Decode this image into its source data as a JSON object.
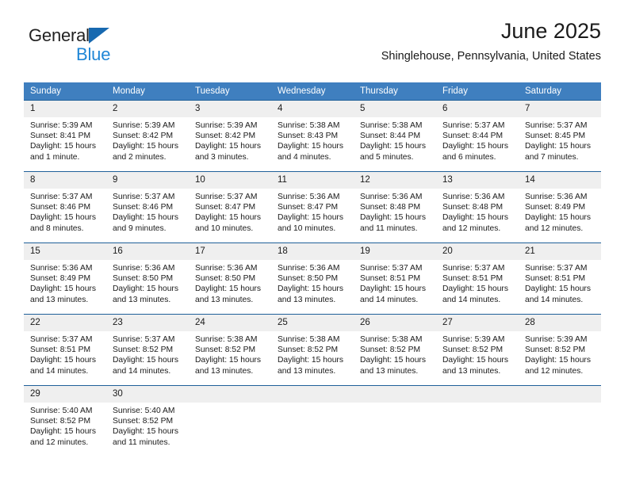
{
  "brand": {
    "name_top": "General",
    "name_bottom": "Blue",
    "accent_color": "#1769b0",
    "blue_text_color": "#1f86d6"
  },
  "header": {
    "title": "June 2025",
    "subtitle": "Shinglehouse, Pennsylvania, United States"
  },
  "theme": {
    "header_row_bg": "#3f7fbf",
    "daynum_bg": "#efefef",
    "grid_line": "#1f6099",
    "text": "#1a1a1a"
  },
  "weekday_headers": [
    "Sunday",
    "Monday",
    "Tuesday",
    "Wednesday",
    "Thursday",
    "Friday",
    "Saturday"
  ],
  "chart_data": {
    "type": "table",
    "title": "June 2025 — Sunrise, Sunset and Daylight",
    "location": "Shinglehouse, Pennsylvania, United States",
    "columns": [
      "Sunday",
      "Monday",
      "Tuesday",
      "Wednesday",
      "Thursday",
      "Friday",
      "Saturday"
    ],
    "days": [
      {
        "date": 1,
        "sunrise": "5:39 AM",
        "sunset": "8:41 PM",
        "daylight_hours": 15,
        "daylight_minutes": 1
      },
      {
        "date": 2,
        "sunrise": "5:39 AM",
        "sunset": "8:42 PM",
        "daylight_hours": 15,
        "daylight_minutes": 2
      },
      {
        "date": 3,
        "sunrise": "5:39 AM",
        "sunset": "8:42 PM",
        "daylight_hours": 15,
        "daylight_minutes": 3
      },
      {
        "date": 4,
        "sunrise": "5:38 AM",
        "sunset": "8:43 PM",
        "daylight_hours": 15,
        "daylight_minutes": 4
      },
      {
        "date": 5,
        "sunrise": "5:38 AM",
        "sunset": "8:44 PM",
        "daylight_hours": 15,
        "daylight_minutes": 5
      },
      {
        "date": 6,
        "sunrise": "5:37 AM",
        "sunset": "8:44 PM",
        "daylight_hours": 15,
        "daylight_minutes": 6
      },
      {
        "date": 7,
        "sunrise": "5:37 AM",
        "sunset": "8:45 PM",
        "daylight_hours": 15,
        "daylight_minutes": 7
      },
      {
        "date": 8,
        "sunrise": "5:37 AM",
        "sunset": "8:46 PM",
        "daylight_hours": 15,
        "daylight_minutes": 8
      },
      {
        "date": 9,
        "sunrise": "5:37 AM",
        "sunset": "8:46 PM",
        "daylight_hours": 15,
        "daylight_minutes": 9
      },
      {
        "date": 10,
        "sunrise": "5:37 AM",
        "sunset": "8:47 PM",
        "daylight_hours": 15,
        "daylight_minutes": 10
      },
      {
        "date": 11,
        "sunrise": "5:36 AM",
        "sunset": "8:47 PM",
        "daylight_hours": 15,
        "daylight_minutes": 10
      },
      {
        "date": 12,
        "sunrise": "5:36 AM",
        "sunset": "8:48 PM",
        "daylight_hours": 15,
        "daylight_minutes": 11
      },
      {
        "date": 13,
        "sunrise": "5:36 AM",
        "sunset": "8:48 PM",
        "daylight_hours": 15,
        "daylight_minutes": 12
      },
      {
        "date": 14,
        "sunrise": "5:36 AM",
        "sunset": "8:49 PM",
        "daylight_hours": 15,
        "daylight_minutes": 12
      },
      {
        "date": 15,
        "sunrise": "5:36 AM",
        "sunset": "8:49 PM",
        "daylight_hours": 15,
        "daylight_minutes": 13
      },
      {
        "date": 16,
        "sunrise": "5:36 AM",
        "sunset": "8:50 PM",
        "daylight_hours": 15,
        "daylight_minutes": 13
      },
      {
        "date": 17,
        "sunrise": "5:36 AM",
        "sunset": "8:50 PM",
        "daylight_hours": 15,
        "daylight_minutes": 13
      },
      {
        "date": 18,
        "sunrise": "5:36 AM",
        "sunset": "8:50 PM",
        "daylight_hours": 15,
        "daylight_minutes": 13
      },
      {
        "date": 19,
        "sunrise": "5:37 AM",
        "sunset": "8:51 PM",
        "daylight_hours": 15,
        "daylight_minutes": 14
      },
      {
        "date": 20,
        "sunrise": "5:37 AM",
        "sunset": "8:51 PM",
        "daylight_hours": 15,
        "daylight_minutes": 14
      },
      {
        "date": 21,
        "sunrise": "5:37 AM",
        "sunset": "8:51 PM",
        "daylight_hours": 15,
        "daylight_minutes": 14
      },
      {
        "date": 22,
        "sunrise": "5:37 AM",
        "sunset": "8:51 PM",
        "daylight_hours": 15,
        "daylight_minutes": 14
      },
      {
        "date": 23,
        "sunrise": "5:37 AM",
        "sunset": "8:52 PM",
        "daylight_hours": 15,
        "daylight_minutes": 14
      },
      {
        "date": 24,
        "sunrise": "5:38 AM",
        "sunset": "8:52 PM",
        "daylight_hours": 15,
        "daylight_minutes": 13
      },
      {
        "date": 25,
        "sunrise": "5:38 AM",
        "sunset": "8:52 PM",
        "daylight_hours": 15,
        "daylight_minutes": 13
      },
      {
        "date": 26,
        "sunrise": "5:38 AM",
        "sunset": "8:52 PM",
        "daylight_hours": 15,
        "daylight_minutes": 13
      },
      {
        "date": 27,
        "sunrise": "5:39 AM",
        "sunset": "8:52 PM",
        "daylight_hours": 15,
        "daylight_minutes": 13
      },
      {
        "date": 28,
        "sunrise": "5:39 AM",
        "sunset": "8:52 PM",
        "daylight_hours": 15,
        "daylight_minutes": 12
      },
      {
        "date": 29,
        "sunrise": "5:40 AM",
        "sunset": "8:52 PM",
        "daylight_hours": 15,
        "daylight_minutes": 12
      },
      {
        "date": 30,
        "sunrise": "5:40 AM",
        "sunset": "8:52 PM",
        "daylight_hours": 15,
        "daylight_minutes": 11
      }
    ]
  },
  "labels": {
    "sunrise_prefix": "Sunrise: ",
    "sunset_prefix": "Sunset: ",
    "daylight_prefix": "Daylight: ",
    "hours_word": "hours",
    "hour_word": "hour",
    "minutes_word": "minutes",
    "minute_word": "minute",
    "and_word": "and",
    "period": "."
  },
  "weeks": [
    [
      1,
      2,
      3,
      4,
      5,
      6,
      7
    ],
    [
      8,
      9,
      10,
      11,
      12,
      13,
      14
    ],
    [
      15,
      16,
      17,
      18,
      19,
      20,
      21
    ],
    [
      22,
      23,
      24,
      25,
      26,
      27,
      28
    ],
    [
      29,
      30,
      null,
      null,
      null,
      null,
      null
    ]
  ]
}
